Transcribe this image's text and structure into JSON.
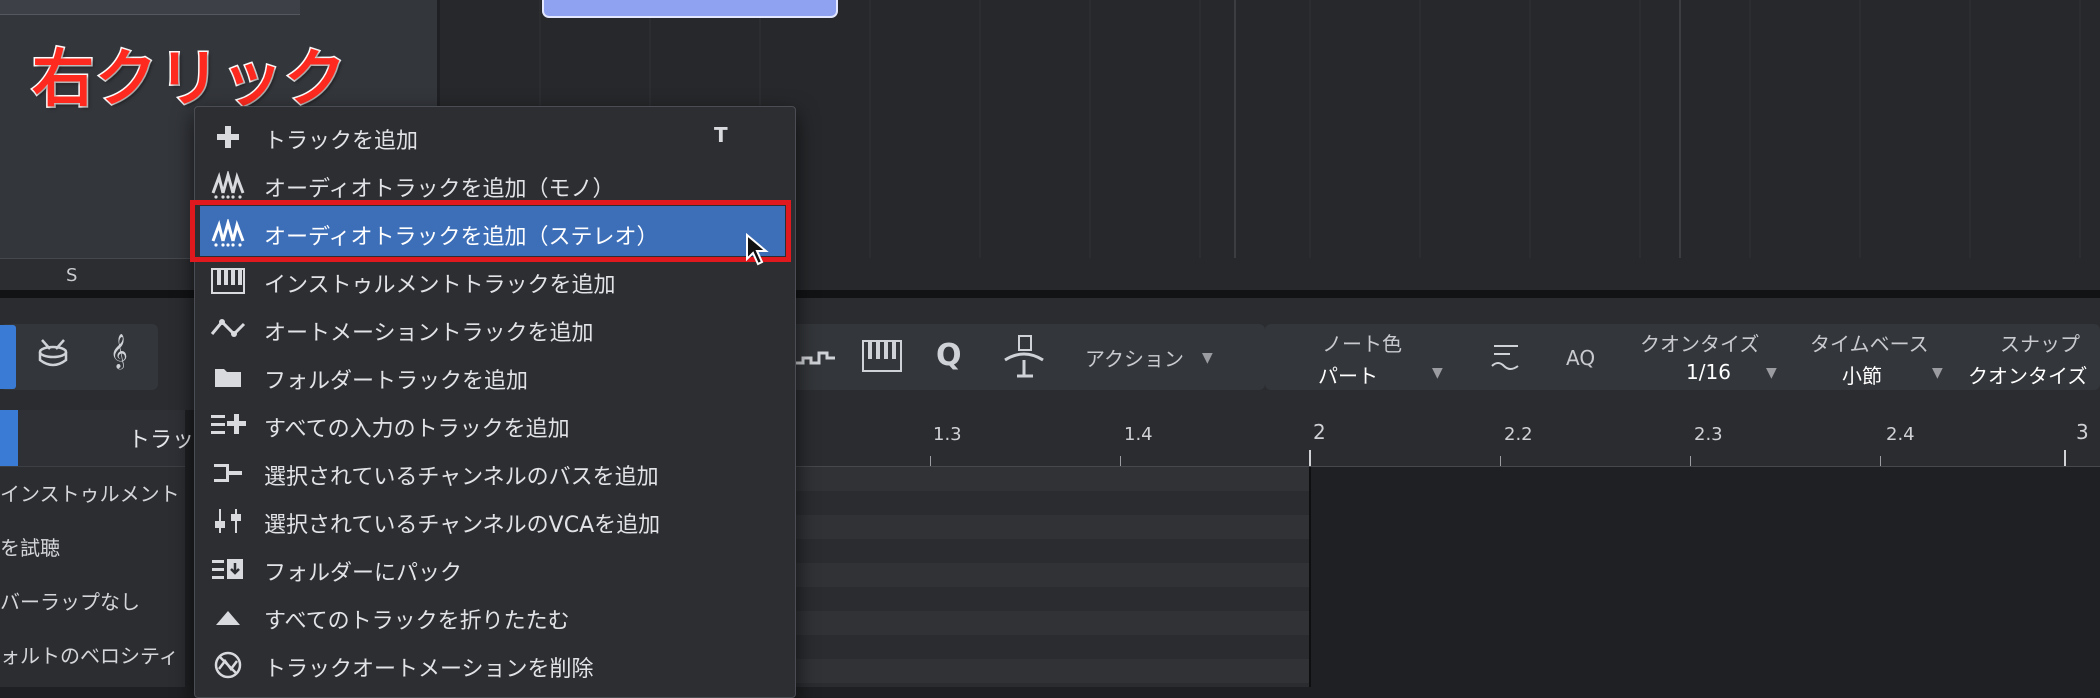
{
  "annotation": {
    "text": "右クリック",
    "color": "#ff2a1f"
  },
  "top_panel": {
    "column_header_label": "S"
  },
  "context_menu": {
    "items": [
      {
        "label": "トラックを追加",
        "shortcut": "T",
        "icon": "plus-icon"
      },
      {
        "label": "オーディオトラックを追加（モノ）",
        "icon": "waveform-icon"
      },
      {
        "label": "オーディオトラックを追加（ステレオ）",
        "icon": "waveform-icon",
        "highlighted": true
      },
      {
        "label": "インストゥルメントトラックを追加",
        "icon": "piano-keys-icon"
      },
      {
        "label": "オートメーショントラックを追加",
        "icon": "automation-curve-icon"
      },
      {
        "label": "フォルダートラックを追加",
        "icon": "folder-icon"
      },
      {
        "label": "すべての入力のトラックを追加",
        "icon": "list-plus-icon"
      },
      {
        "label": "選択されているチャンネルのバスを追加",
        "icon": "bus-icon"
      },
      {
        "label": "選択されているチャンネルのVCAを追加",
        "icon": "vca-fader-icon"
      },
      {
        "label": "フォルダーにパック",
        "icon": "pack-folder-icon"
      },
      {
        "label": "すべてのトラックを折りたたむ",
        "icon": "collapse-triangle-icon"
      },
      {
        "label": "トラックオートメーションを削除",
        "icon": "remove-automation-icon"
      }
    ]
  },
  "toolbar": {
    "action_label": "アクション",
    "note_color_label": "ノート色",
    "note_color_value": "パート",
    "aq_label": "AQ",
    "quantize_label": "クオンタイズ",
    "quantize_value": "1/16",
    "timebase_label": "タイムベース",
    "timebase_value": "小節",
    "snap_label": "スナップ",
    "snap_value": "クオンタイズ"
  },
  "inspector": {
    "track_label": "トラッ",
    "items": [
      "インストゥルメント",
      "を試聴",
      "バーラップなし",
      "ォルトのベロシティ"
    ]
  },
  "ruler": {
    "labels": [
      "1.3",
      "1.4",
      "2",
      "2.2",
      "2.3",
      "2.4",
      "3"
    ]
  },
  "colors": {
    "highlight": "#3d6eb8",
    "annotation_box": "#e0191f",
    "clip": "#8fa2f2"
  }
}
